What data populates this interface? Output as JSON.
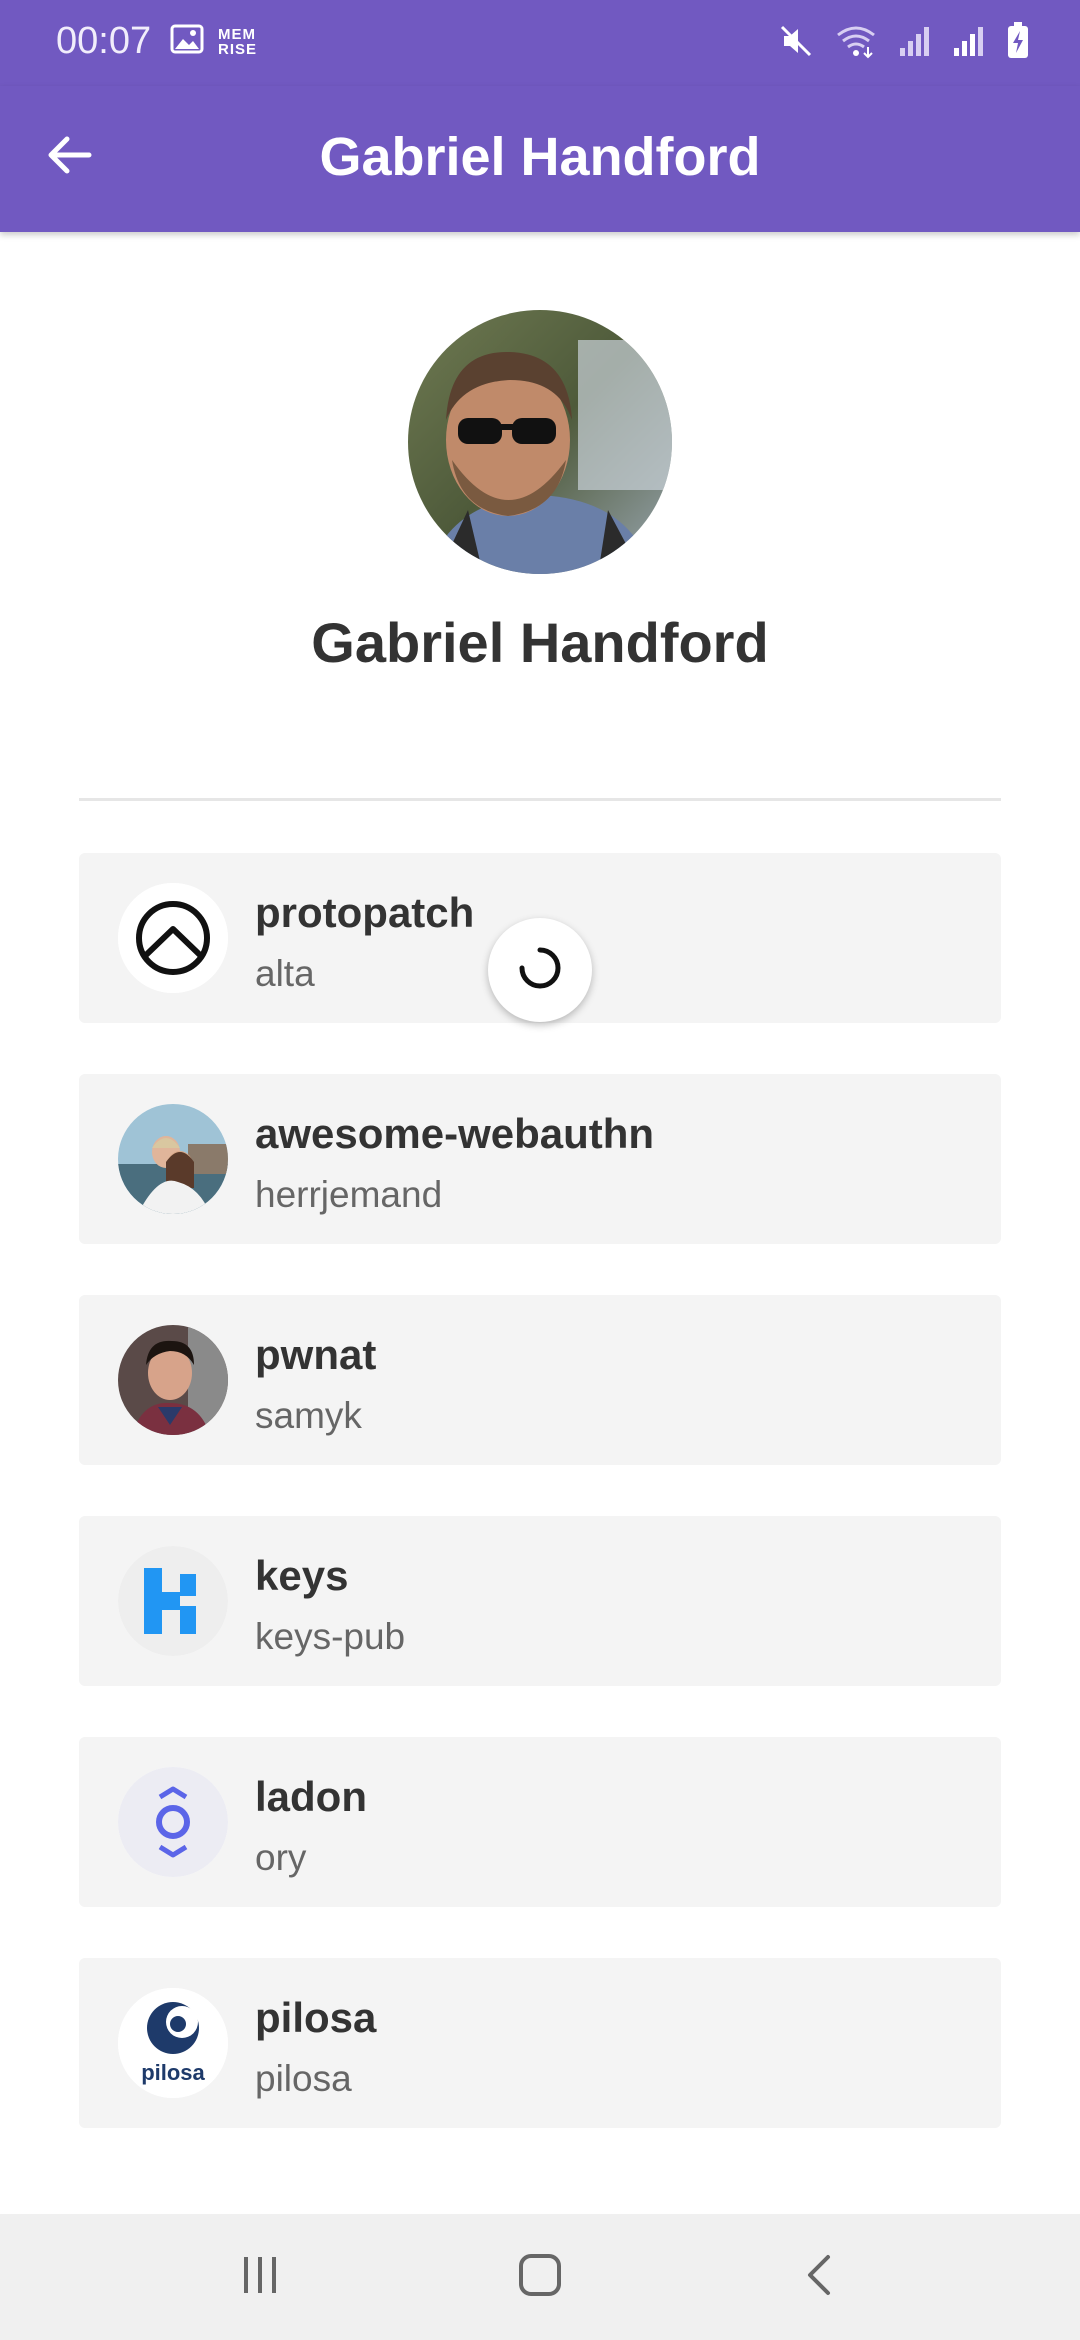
{
  "status_bar": {
    "time": "00:07",
    "memrise_badge": [
      "MEM",
      "RISE"
    ],
    "icons": [
      "image-icon",
      "mute-icon",
      "wifi-icon",
      "signal-icon",
      "signal-icon-2",
      "battery-charging-icon"
    ]
  },
  "app_bar": {
    "title": "Gabriel Handford",
    "background": "#7159c1"
  },
  "profile": {
    "name": "Gabriel Handford"
  },
  "repos": [
    {
      "title": "protopatch",
      "owner": "alta",
      "avatar_icon": "alta-logo-icon"
    },
    {
      "title": "awesome-webauthn",
      "owner": "herrjemand",
      "avatar_icon": "couple-photo-avatar"
    },
    {
      "title": "pwnat",
      "owner": "samyk",
      "avatar_icon": "man-photo-avatar"
    },
    {
      "title": "keys",
      "owner": "keys-pub",
      "avatar_icon": "keys-logo-icon"
    },
    {
      "title": "ladon",
      "owner": "ory",
      "avatar_icon": "ory-logo-icon"
    },
    {
      "title": "pilosa",
      "owner": "pilosa",
      "avatar_icon": "pilosa-logo-icon",
      "logo_text": "pilosa"
    }
  ],
  "loading": true
}
